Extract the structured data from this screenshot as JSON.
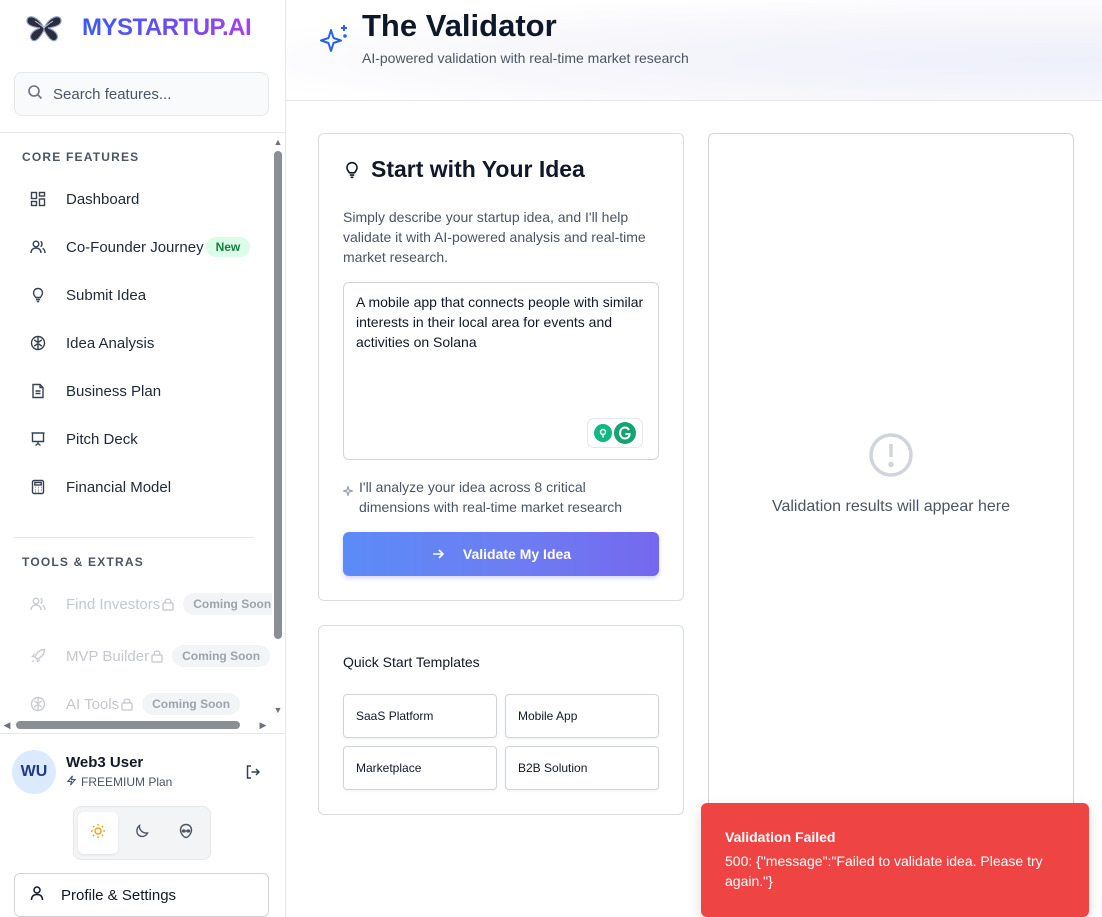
{
  "brand": {
    "name": "MYSTARTUP.AI",
    "logo_icon": "butterfly-logo-icon"
  },
  "search": {
    "placeholder": "Search features..."
  },
  "sidebar": {
    "core_title": "CORE FEATURES",
    "core_items": [
      {
        "label": "Dashboard",
        "icon": "dashboard-icon"
      },
      {
        "label": "Co-Founder Journey",
        "icon": "users-icon",
        "badge": "New"
      },
      {
        "label": "Submit Idea",
        "icon": "lightbulb-icon"
      },
      {
        "label": "Idea Analysis",
        "icon": "brain-icon"
      },
      {
        "label": "Business Plan",
        "icon": "document-icon"
      },
      {
        "label": "Pitch Deck",
        "icon": "presentation-icon"
      },
      {
        "label": "Financial Model",
        "icon": "calculator-icon"
      }
    ],
    "tools_title": "TOOLS & EXTRAS",
    "tools_items": [
      {
        "label": "Find Investors",
        "icon": "users-icon",
        "badge": "Coming Soon"
      },
      {
        "label": "MVP Builder",
        "icon": "rocket-icon",
        "badge": "Coming Soon"
      },
      {
        "label": "AI Tools",
        "icon": "brain-icon",
        "badge": "Coming Soon"
      }
    ]
  },
  "user": {
    "initials": "WU",
    "name": "Web3 User",
    "plan": "FREEMIUM Plan"
  },
  "theme": {
    "options": [
      "light",
      "dark",
      "alien"
    ],
    "selected": "light"
  },
  "profile": {
    "label": "Profile & Settings"
  },
  "header": {
    "title": "The Validator",
    "subtitle": "AI-powered validation with real-time market research"
  },
  "idea_card": {
    "title": "Start with Your Idea",
    "description": "Simply describe your startup idea, and I'll help validate it with AI-powered analysis and real-time market research.",
    "input_value": "A mobile app that connects people with similar interests in their local area for events and activities on Solana",
    "analyze_note": "I'll analyze your idea across 8 critical dimensions with real-time market research",
    "button_label": "Validate My Idea"
  },
  "templates": {
    "title": "Quick Start Templates",
    "items": [
      "SaaS Platform",
      "Mobile App",
      "Marketplace",
      "B2B Solution"
    ]
  },
  "results": {
    "placeholder": "Validation results will appear here"
  },
  "toast": {
    "title": "Validation Failed",
    "message": "500: {\"message\":\"Failed to validate idea. Please try again.\"}",
    "color": "#ef4444"
  },
  "colors": {
    "accent": "#3b5bf6",
    "brand_gradient_end": "#a442f0",
    "success_badge": "#dcfce7",
    "error": "#ef4444"
  }
}
